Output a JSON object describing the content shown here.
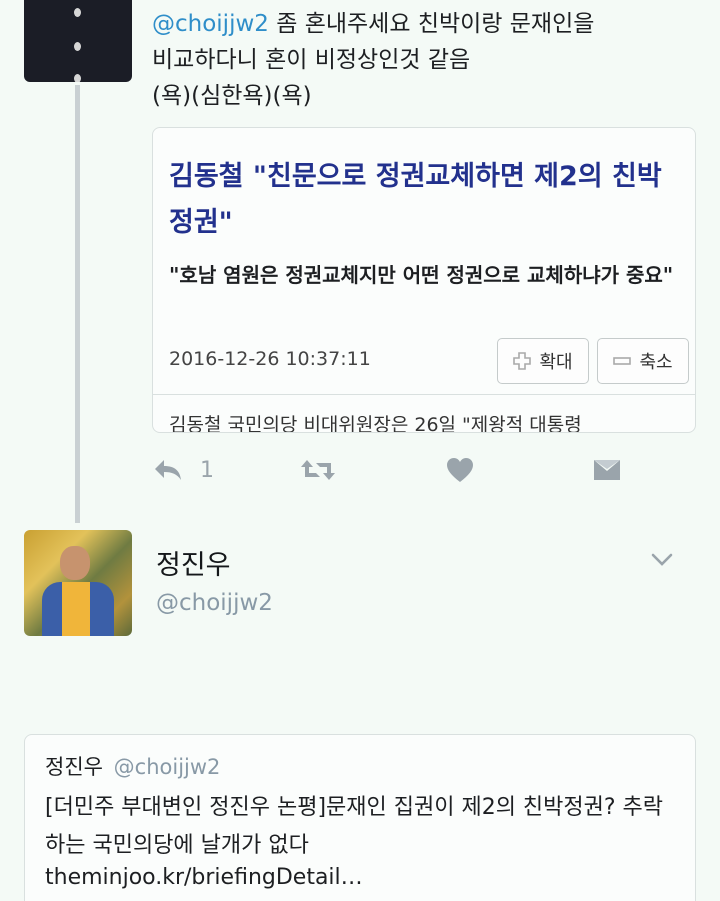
{
  "reply": {
    "mention": "@choijjw2",
    "line1_rest": " 좀 혼내주세요 친박이랑 문재인을",
    "line2": "비교하다니 혼이 비정상인것 같음",
    "line3": "(욕)(심한욕)(욕)"
  },
  "card": {
    "title": "김동철 \"친문으로 정권교체하면 제2의 친박정권\"",
    "subtitle": "\"호남 염원은 정권교체지만 어떤 정권으로 교체하냐가 중요\"",
    "date": "2016-12-26 10:37:11",
    "zoom_in_label": "확대",
    "zoom_out_label": "축소",
    "preview": "김동철 국민의당 비대위원장은 26일 \"제왕적 대통령"
  },
  "actions": {
    "reply_count": "1",
    "icons": [
      "reply-icon",
      "retweet-icon",
      "like-icon",
      "message-icon"
    ]
  },
  "profile": {
    "name": "정진우",
    "handle": "@choijjw2"
  },
  "quote": {
    "name": "정진우",
    "handle": "@choijjw2",
    "text": "[더민주 부대변인 정진우 논평]문재인 집권이 제2의 친박정권? 추락하는 국민의당에 날개가 없다",
    "link": "theminjoo.kr/briefingDetail…"
  },
  "colors": {
    "background": "#f4faf6",
    "link": "#2f8ec9",
    "card_title": "#22318d",
    "muted": "#8899a6"
  }
}
